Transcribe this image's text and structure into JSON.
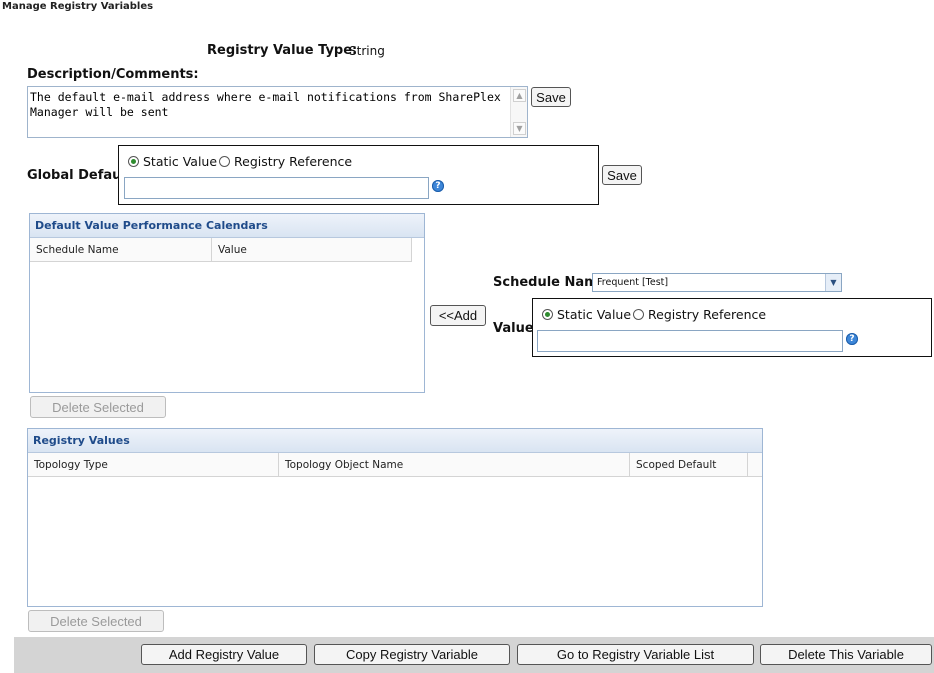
{
  "page": {
    "title": "Manage Registry Variables"
  },
  "registry_type": {
    "label": "Registry Value Type:",
    "value": "String"
  },
  "description": {
    "label": "Description/Comments:",
    "text": "The default e-mail address where e-mail notifications from SharePlex Manager will be sent",
    "save_label": "Save"
  },
  "global_default": {
    "label": "Global Default",
    "radio_static": "Static Value",
    "radio_reference": "Registry Reference",
    "selected": "static",
    "value": "",
    "save_label": "Save"
  },
  "calendars": {
    "title": "Default Value Performance Calendars",
    "columns": [
      "Schedule Name",
      "Value"
    ],
    "rows": [],
    "delete_label": "Delete Selected"
  },
  "add_button": {
    "label": "<<Add"
  },
  "schedule": {
    "label": "Schedule Name",
    "selected": "Frequent [Test]",
    "value_label": "Value",
    "radio_static": "Static Value",
    "radio_reference": "Registry Reference",
    "value": ""
  },
  "registry_values": {
    "title": "Registry Values",
    "columns": [
      "Topology Type",
      "Topology Object Name",
      "Scoped Default"
    ],
    "rows": [],
    "delete_label": "Delete Selected"
  },
  "footer": {
    "buttons": [
      "Add Registry Value",
      "Copy Registry Variable",
      "Go to Registry Variable List",
      "Delete This Variable"
    ]
  },
  "icons": {
    "help": "help-icon",
    "scroll_up": "scroll-up-arrow-icon",
    "scroll_down": "scroll-down-arrow-icon",
    "dropdown": "chevron-down-icon"
  },
  "colors": {
    "grid_title": "#1f4b8a",
    "radio_selected": "#2e8b2e",
    "help_icon": "#3d86d8",
    "footer_bar": "#d4d4d4"
  }
}
